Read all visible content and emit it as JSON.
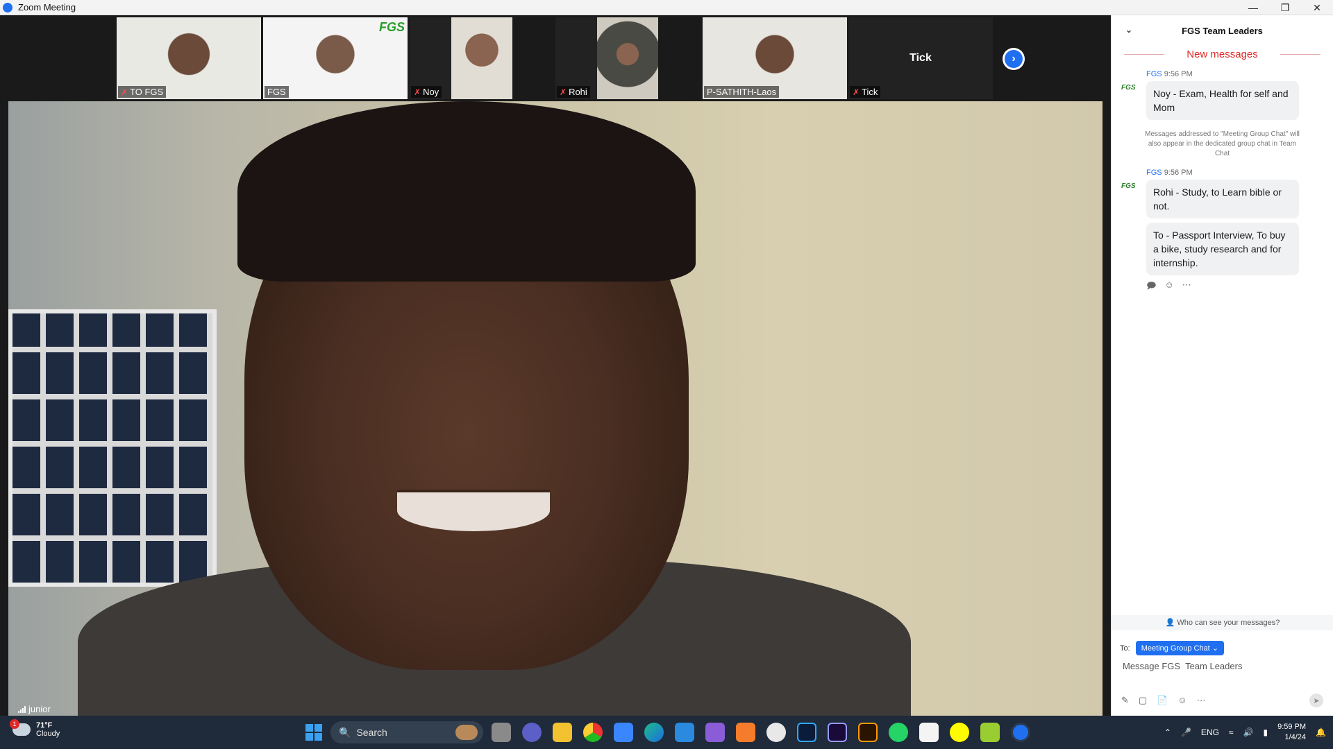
{
  "window": {
    "title": "Zoom Meeting"
  },
  "participants": [
    {
      "name": "TO FGS",
      "muted": true
    },
    {
      "name": "FGS",
      "muted": false
    },
    {
      "name": "Noy",
      "muted": true
    },
    {
      "name": "Rohi",
      "muted": true
    },
    {
      "name": "P-SATHITH-Laos",
      "muted": false
    },
    {
      "name": "Tick",
      "muted": true,
      "center_label": "Tick"
    }
  ],
  "main_video": {
    "name": "junior"
  },
  "chat": {
    "title": "FGS  Team Leaders",
    "new_messages_label": "New messages",
    "avatar_text": "FGS",
    "messages": [
      {
        "sender": "FGS",
        "time": "9:56 PM",
        "bubbles": [
          "Noy - Exam, Health for self and Mom"
        ]
      },
      {
        "sender": "FGS",
        "time": "9:56 PM",
        "bubbles": [
          "Rohi - Study, to Learn bible or not.",
          "To - Passport Interview, To buy a bike, study research and for internship."
        ]
      }
    ],
    "system_note": "Messages addressed to \"Meeting Group Chat\" will also appear in the dedicated group chat in Team Chat",
    "who_can_see": "Who can see your messages?",
    "to_label": "To:",
    "to_value": "Meeting Group Chat",
    "input_placeholder": "Message FGS  Team Leaders"
  },
  "taskbar": {
    "weather_temp": "71°F",
    "weather_desc": "Cloudy",
    "weather_badge": "1",
    "search_label": "Search",
    "language": "ENG",
    "time": "9:59 PM",
    "date": "1/4/24"
  },
  "colors": {
    "accent": "#1f6ff0",
    "new_messages": "#e02828",
    "taskbar": "#1f2b3a"
  }
}
